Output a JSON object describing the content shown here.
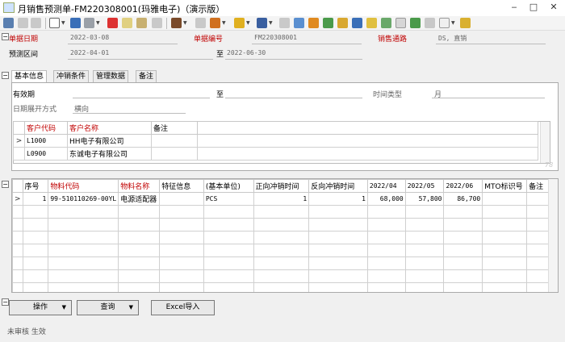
{
  "window": {
    "title": "月销售预测单-FM220308001(玛雅电子)（演示版）"
  },
  "header": {
    "bill_date_label": "单据日期",
    "bill_date_value": "2022-03-08",
    "bill_no_label": "单据编号",
    "bill_no_value": "FM220308001",
    "channel_label": "销售通路",
    "channel_value": "DS, 直销",
    "period_label": "预测区间",
    "period_from": "2022-04-01",
    "period_to_label": "至",
    "period_to": "2022-06-30"
  },
  "tabs": [
    {
      "label": "基本信息"
    },
    {
      "label": "冲销条件"
    },
    {
      "label": "管理数据"
    },
    {
      "label": "备注"
    }
  ],
  "basic": {
    "valid_label": "有效期",
    "valid_to_label": "至",
    "time_type_label": "时间类型",
    "time_type_value": "月",
    "expand_label": "日期展开方式",
    "expand_value": "横向"
  },
  "customers": {
    "columns": [
      "客户代码",
      "客户名称",
      "备注"
    ],
    "rows": [
      {
        "indicator": ">",
        "code": "L1000",
        "name": "HH电子有限公司",
        "note": ""
      },
      {
        "indicator": "",
        "code": "L0900",
        "name": "东诚电子有限公司",
        "note": ""
      }
    ],
    "watermark": "78"
  },
  "detail": {
    "columns": [
      "序号",
      "物料代码",
      "物料名称",
      "特征信息",
      "(基本单位)",
      "正向冲销时间",
      "反向冲销时间",
      "2022/04",
      "2022/05",
      "2022/06",
      "MTO标识号",
      "备注"
    ],
    "rows": [
      {
        "indicator": ">",
        "seq": "1",
        "code": "99-510110269-00YL",
        "name": "电源适配器",
        "feature": "",
        "unit": "PCS",
        "fwd": "1",
        "rev": "1",
        "m1": "68,000",
        "m2": "57,800",
        "m3": "86,700",
        "mto": "",
        "note": ""
      }
    ]
  },
  "buttons": {
    "operate": "操作",
    "query": "查询",
    "excel": "Excel导入"
  },
  "status": {
    "text": "未审核 生效"
  }
}
